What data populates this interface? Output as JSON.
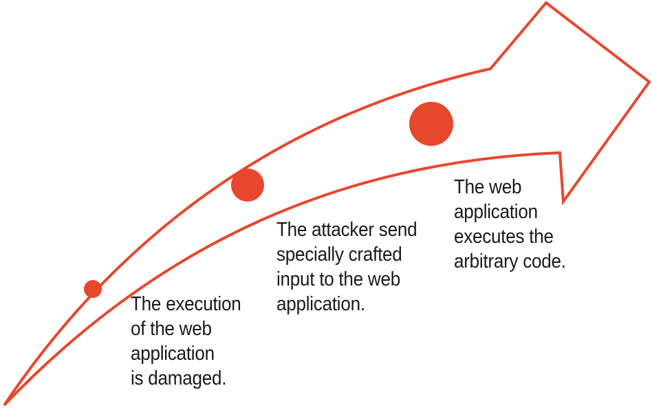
{
  "colors": {
    "accent": "#e8472e",
    "text": "#1a1a1a",
    "background": "#ffffff"
  },
  "steps": [
    {
      "lines": [
        "The execution",
        "of the web",
        "application",
        "is damaged."
      ]
    },
    {
      "lines": [
        "The attacker send",
        "specially crafted",
        "input to the web",
        "application."
      ]
    },
    {
      "lines": [
        "The web",
        "application",
        "executes the",
        "arbitrary code."
      ]
    }
  ]
}
